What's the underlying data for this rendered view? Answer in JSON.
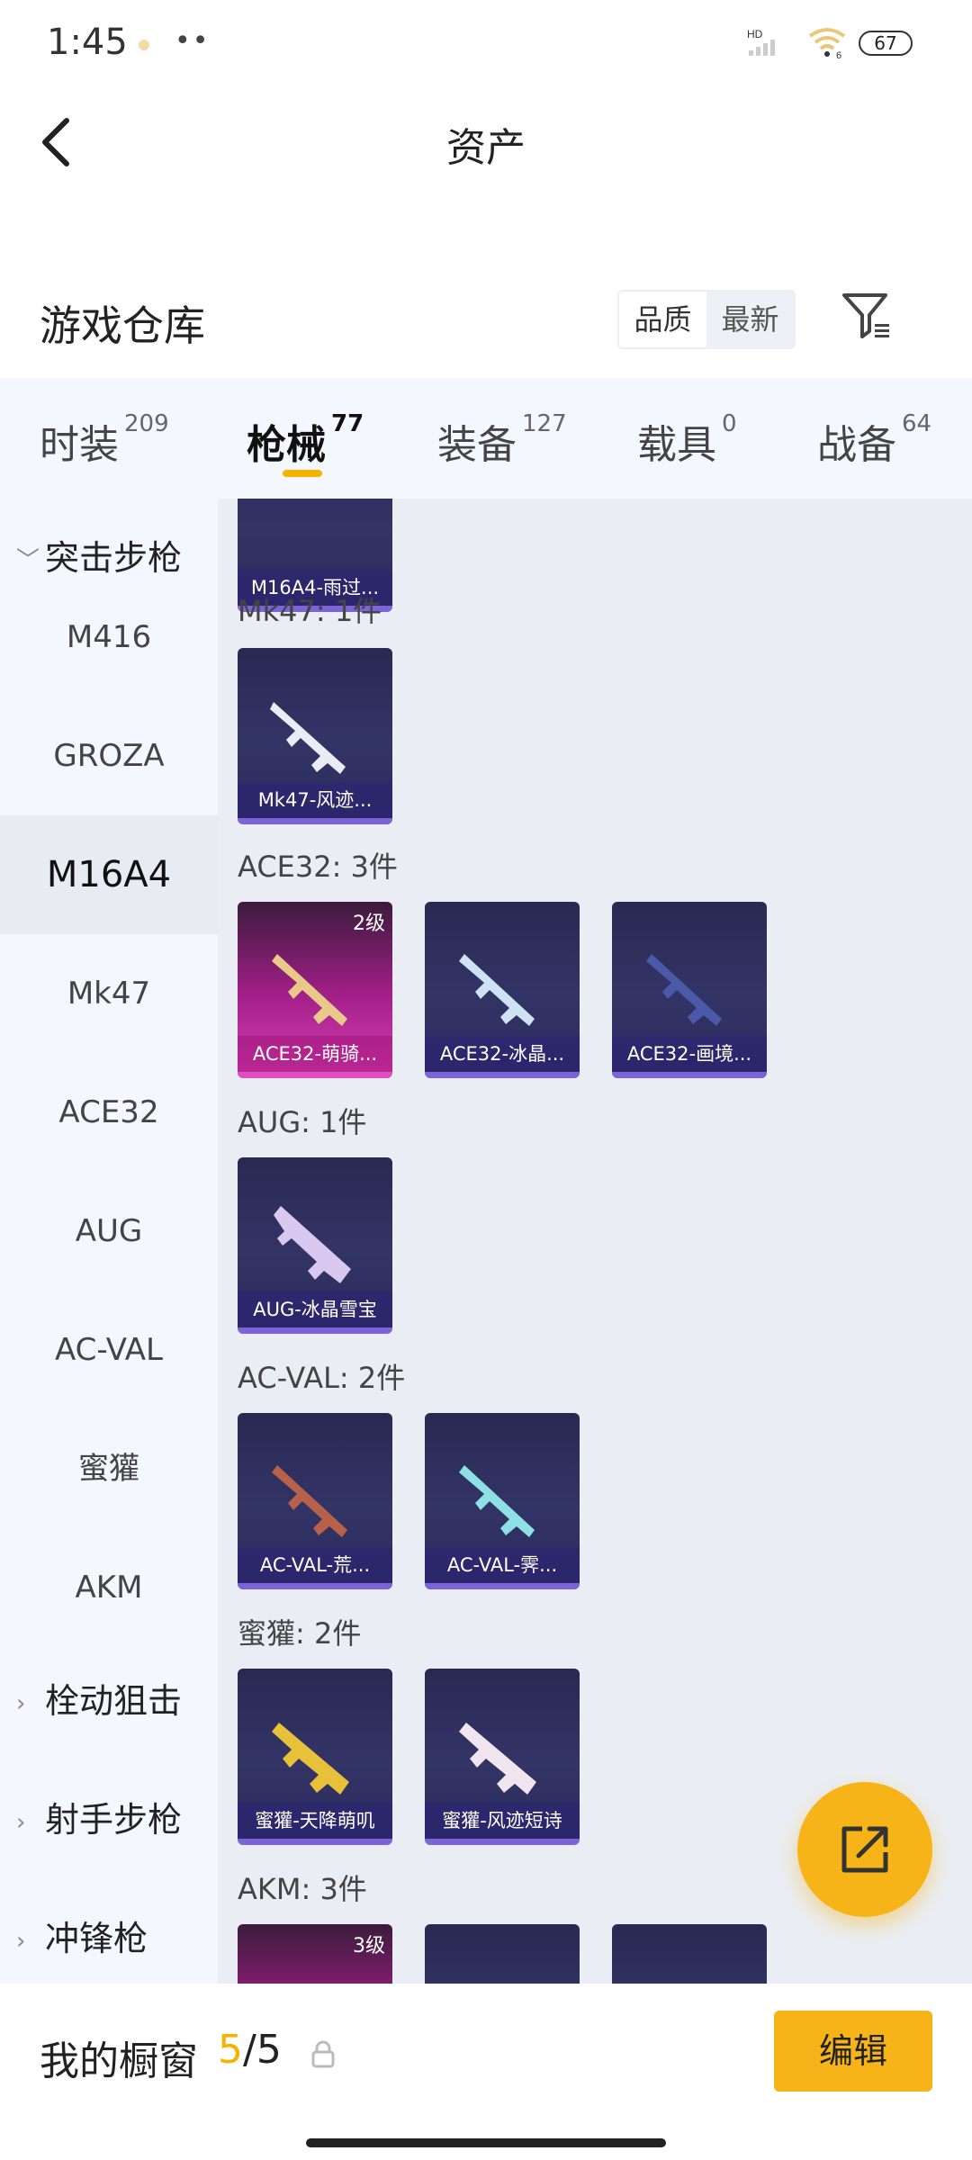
{
  "status": {
    "time": "1:45",
    "dots": "••",
    "signal_label": "HD",
    "wifi_label": "6",
    "battery": "67"
  },
  "nav": {
    "title": "资产"
  },
  "warehouse": {
    "title": "游戏仓库",
    "sort_options": [
      "品质",
      "最新"
    ],
    "active_sort": "品质"
  },
  "tabs": [
    {
      "label": "时装",
      "count": "209"
    },
    {
      "label": "枪械",
      "count": "77"
    },
    {
      "label": "装备",
      "count": "127"
    },
    {
      "label": "载具",
      "count": "0"
    },
    {
      "label": "战备",
      "count": "64"
    }
  ],
  "active_tab": "枪械",
  "sidebar": {
    "groups": [
      {
        "label": "突击步枪",
        "expanded": true
      },
      {
        "label": "栓动狙击",
        "expanded": false
      },
      {
        "label": "射手步枪",
        "expanded": false
      },
      {
        "label": "冲锋枪",
        "expanded": false
      }
    ],
    "items": [
      "M416",
      "GROZA",
      "M16A4",
      "Mk47",
      "ACE32",
      "AUG",
      "AC-VAL",
      "蜜獾",
      "AKM"
    ],
    "active_item": "M16A4"
  },
  "sections": [
    {
      "label": "",
      "items": [
        {
          "name": "M16A4-雨过..."
        }
      ]
    },
    {
      "label": "Mk47: 1件",
      "items": [
        {
          "name": "Mk47-风迹..."
        }
      ]
    },
    {
      "label": "ACE32: 3件",
      "items": [
        {
          "name": "ACE32-萌骑...",
          "level": "2级",
          "style": "pink"
        },
        {
          "name": "ACE32-冰晶..."
        },
        {
          "name": "ACE32-画境..."
        }
      ]
    },
    {
      "label": "AUG: 1件",
      "items": [
        {
          "name": "AUG-冰晶雪宝"
        }
      ]
    },
    {
      "label": "AC-VAL: 2件",
      "items": [
        {
          "name": "AC-VAL-荒..."
        },
        {
          "name": "AC-VAL-霁..."
        }
      ]
    },
    {
      "label": "蜜獾: 2件",
      "items": [
        {
          "name": "蜜獾-天降萌叽"
        },
        {
          "name": "蜜獾-风迹短诗"
        }
      ]
    },
    {
      "label": "AKM: 3件",
      "items": [
        {
          "name": "",
          "level": "3级",
          "style": "pink"
        },
        {
          "name": ""
        },
        {
          "name": ""
        }
      ]
    }
  ],
  "bottom": {
    "label": "我的橱窗",
    "count_current": "5",
    "count_sep": "/",
    "count_total": "5",
    "edit_label": "编辑"
  },
  "colors": {
    "accent": "#f7b418",
    "card_bg": "#2e3060",
    "card_pink": "#b8279a"
  }
}
